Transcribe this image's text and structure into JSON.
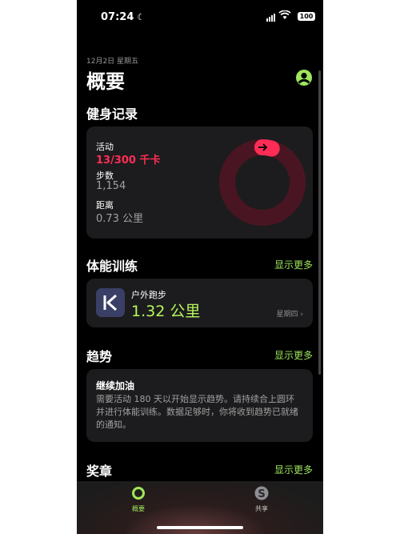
{
  "status_bar": {
    "time": "07:24",
    "battery": "100"
  },
  "header": {
    "date": "12月2日 星期五",
    "title": "概要"
  },
  "fitness": {
    "section_title": "健身记录",
    "activity_label": "活动",
    "activity_value": "13/300 千卡",
    "activity_progress": 0.043,
    "steps_label": "步数",
    "steps_value": "1,154",
    "distance_label": "距离",
    "distance_value": "0.73 公里"
  },
  "workouts": {
    "section_title": "体能训练",
    "more": "显示更多",
    "item_name": "户外跑步",
    "item_distance": "1.32 公里",
    "item_day": "星期四"
  },
  "trends": {
    "section_title": "趋势",
    "more": "显示更多",
    "card_title": "继续加油",
    "card_body": "需要活动 180 天以开始显示趋势。请持续合上圆环并进行体能训练。数据足够时，你将收到趋势已就绪的通知。"
  },
  "awards": {
    "section_title": "奖章",
    "more": "显示更多"
  },
  "tabs": [
    {
      "label": "概要",
      "active": true
    },
    {
      "label": "共享",
      "active": false
    }
  ],
  "colors": {
    "accent": "#9fe65b",
    "move_ring": "#ff2d55"
  }
}
